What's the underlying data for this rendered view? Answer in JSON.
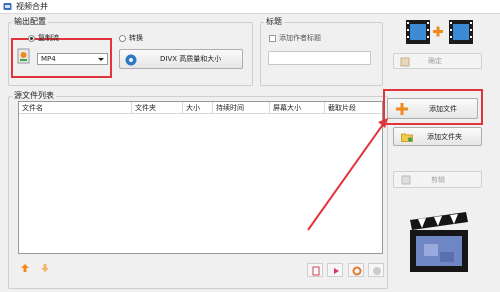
{
  "window": {
    "title": "视频合并"
  },
  "output_config": {
    "legend": "输出配置",
    "copy_stream_label": "复制流",
    "format_value": "MP4",
    "convert_label": "转换",
    "quality_button_label": "DIVX 高质量和大小"
  },
  "title_group": {
    "legend": "标题",
    "add_author_title_label": "添加作者标题"
  },
  "confirm_button_label": "确定",
  "source_list": {
    "legend": "源文件列表",
    "columns": [
      "文件名",
      "文件夹",
      "大小",
      "持续时间",
      "屏幕大小",
      "截取片段"
    ]
  },
  "side_buttons": {
    "add_file_label": "添加文件",
    "add_folder_label": "添加文件夹",
    "clip_label": "剪辑"
  },
  "colors": {
    "highlight": "#e0353b",
    "accent_orange": "#f08a1c",
    "accent_green": "#3ea34a"
  }
}
